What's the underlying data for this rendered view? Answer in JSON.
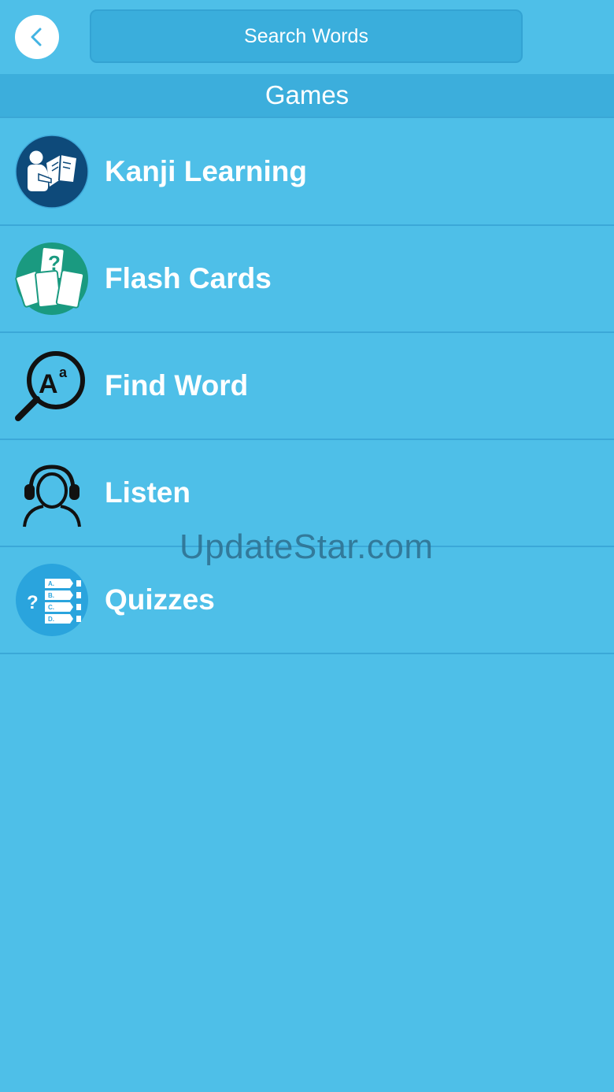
{
  "topbar": {
    "back_icon": "chevron-left-icon",
    "search_placeholder": "Search Words"
  },
  "section": {
    "title": "Games"
  },
  "menu": [
    {
      "label": "Kanji Learning",
      "icon": "reading-person-icon",
      "icon_color": "#0E4A7A"
    },
    {
      "label": "Flash Cards",
      "icon": "flash-cards-icon",
      "icon_color": "#1A9A80"
    },
    {
      "label": "Find Word",
      "icon": "magnifier-icon",
      "icon_color": "#111111"
    },
    {
      "label": "Listen",
      "icon": "headset-person-icon",
      "icon_color": "#111111"
    },
    {
      "label": "Quizzes",
      "icon": "quiz-list-icon",
      "icon_color": "#2AA4DD"
    }
  ],
  "watermark": {
    "text": "UpdateStar.com"
  },
  "colors": {
    "background": "#4EBFE8",
    "header": "#3CAEDC",
    "search": "#3AAEDC",
    "text": "#FFFFFF"
  }
}
